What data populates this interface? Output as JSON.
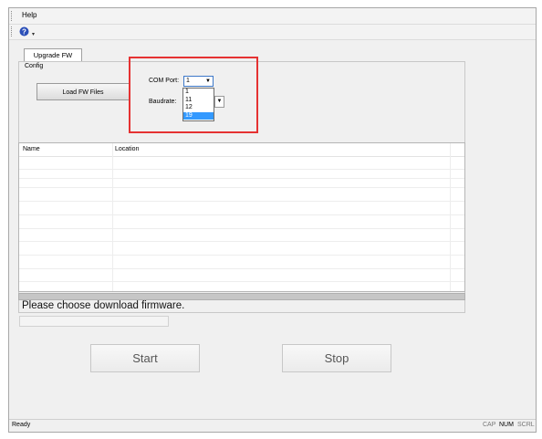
{
  "menu": {
    "help": "Help"
  },
  "toolbar": {
    "icon": "help-icon"
  },
  "tab": {
    "label": "Upgrade FW"
  },
  "config": {
    "label": "Config",
    "load_button": "Load FW Files",
    "com_port_label": "COM Port:",
    "com_port_value": "1",
    "com_port_options": [
      "1",
      "11",
      "12",
      "19"
    ],
    "com_port_highlighted": "19",
    "baudrate_label": "Baudrate:"
  },
  "table": {
    "columns": [
      "Name",
      "Location"
    ],
    "rows": []
  },
  "message": "Please choose download firmware.",
  "buttons": {
    "start": "Start",
    "stop": "Stop"
  },
  "statusbar": {
    "ready": "Ready",
    "cap": "CAP",
    "num": "NUM",
    "scrl": "SCRL"
  },
  "colors": {
    "highlight": "#e53232",
    "selection": "#3399ff"
  }
}
